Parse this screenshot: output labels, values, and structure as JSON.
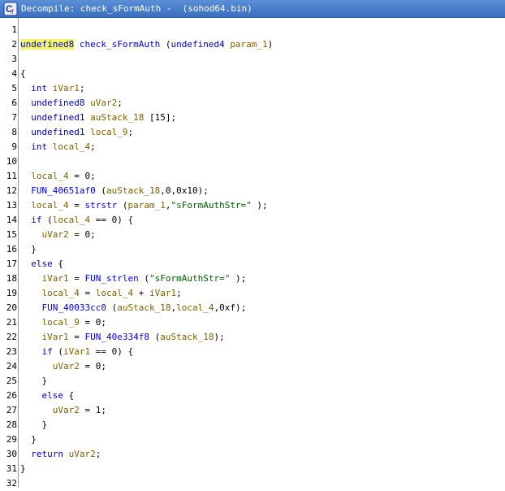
{
  "window": {
    "title": "Decompile: check_sFormAuth -  (sohod64.bin)",
    "icon": "ghidra-decompiler-icon"
  },
  "code_lines": [
    {
      "n": "1",
      "tokens": []
    },
    {
      "n": "2",
      "tokens": [
        {
          "t": "undefined8",
          "c": "kw",
          "hl": true
        },
        {
          "t": " ",
          "c": "pl"
        },
        {
          "t": "check_sFormAuth",
          "c": "fn"
        },
        {
          "t": " (",
          "c": "pl"
        },
        {
          "t": "undefined4",
          "c": "kw"
        },
        {
          "t": " ",
          "c": "pl"
        },
        {
          "t": "param_1",
          "c": "var"
        },
        {
          "t": ")",
          "c": "pl"
        }
      ]
    },
    {
      "n": "3",
      "tokens": []
    },
    {
      "n": "4",
      "tokens": [
        {
          "t": "{",
          "c": "pl"
        }
      ]
    },
    {
      "n": "5",
      "tokens": [
        {
          "t": "  ",
          "c": "pl"
        },
        {
          "t": "int",
          "c": "kw"
        },
        {
          "t": " ",
          "c": "pl"
        },
        {
          "t": "iVar1",
          "c": "var"
        },
        {
          "t": ";",
          "c": "pl"
        }
      ]
    },
    {
      "n": "6",
      "tokens": [
        {
          "t": "  ",
          "c": "pl"
        },
        {
          "t": "undefined8",
          "c": "kw"
        },
        {
          "t": " ",
          "c": "pl"
        },
        {
          "t": "uVar2",
          "c": "var"
        },
        {
          "t": ";",
          "c": "pl"
        }
      ]
    },
    {
      "n": "7",
      "tokens": [
        {
          "t": "  ",
          "c": "pl"
        },
        {
          "t": "undefined1",
          "c": "kw"
        },
        {
          "t": " ",
          "c": "pl"
        },
        {
          "t": "auStack_18",
          "c": "var"
        },
        {
          "t": " [15];",
          "c": "pl"
        }
      ]
    },
    {
      "n": "8",
      "tokens": [
        {
          "t": "  ",
          "c": "pl"
        },
        {
          "t": "undefined1",
          "c": "kw"
        },
        {
          "t": " ",
          "c": "pl"
        },
        {
          "t": "local_9",
          "c": "var"
        },
        {
          "t": ";",
          "c": "pl"
        }
      ]
    },
    {
      "n": "9",
      "tokens": [
        {
          "t": "  ",
          "c": "pl"
        },
        {
          "t": "int",
          "c": "kw"
        },
        {
          "t": " ",
          "c": "pl"
        },
        {
          "t": "local_4",
          "c": "var"
        },
        {
          "t": ";",
          "c": "pl"
        }
      ]
    },
    {
      "n": "10",
      "tokens": []
    },
    {
      "n": "11",
      "tokens": [
        {
          "t": "  ",
          "c": "pl"
        },
        {
          "t": "local_4",
          "c": "var"
        },
        {
          "t": " = 0;",
          "c": "pl"
        }
      ]
    },
    {
      "n": "12",
      "tokens": [
        {
          "t": "  ",
          "c": "pl"
        },
        {
          "t": "FUN_40651af0",
          "c": "fn"
        },
        {
          "t": " (",
          "c": "pl"
        },
        {
          "t": "auStack_18",
          "c": "var"
        },
        {
          "t": ",0,0x10);",
          "c": "pl"
        }
      ]
    },
    {
      "n": "13",
      "tokens": [
        {
          "t": "  ",
          "c": "pl"
        },
        {
          "t": "local_4",
          "c": "var"
        },
        {
          "t": " = ",
          "c": "pl"
        },
        {
          "t": "strstr",
          "c": "fn"
        },
        {
          "t": " (",
          "c": "pl"
        },
        {
          "t": "param_1",
          "c": "var"
        },
        {
          "t": ",",
          "c": "pl"
        },
        {
          "t": "\"sFormAuthStr=\"",
          "c": "str"
        },
        {
          "t": " );",
          "c": "pl"
        }
      ]
    },
    {
      "n": "14",
      "tokens": [
        {
          "t": "  ",
          "c": "pl"
        },
        {
          "t": "if",
          "c": "kw"
        },
        {
          "t": " (",
          "c": "pl"
        },
        {
          "t": "local_4",
          "c": "var"
        },
        {
          "t": " == 0) {",
          "c": "pl"
        }
      ]
    },
    {
      "n": "15",
      "tokens": [
        {
          "t": "    ",
          "c": "pl"
        },
        {
          "t": "uVar2",
          "c": "var"
        },
        {
          "t": " = 0;",
          "c": "pl"
        }
      ]
    },
    {
      "n": "16",
      "tokens": [
        {
          "t": "  }",
          "c": "pl"
        }
      ]
    },
    {
      "n": "17",
      "tokens": [
        {
          "t": "  ",
          "c": "pl"
        },
        {
          "t": "else",
          "c": "kw"
        },
        {
          "t": " {",
          "c": "pl"
        }
      ]
    },
    {
      "n": "18",
      "tokens": [
        {
          "t": "    ",
          "c": "pl"
        },
        {
          "t": "iVar1",
          "c": "var"
        },
        {
          "t": " = ",
          "c": "pl"
        },
        {
          "t": "FUN_strlen",
          "c": "fn"
        },
        {
          "t": " (",
          "c": "pl"
        },
        {
          "t": "\"sFormAuthStr=\"",
          "c": "str"
        },
        {
          "t": " );",
          "c": "pl"
        }
      ]
    },
    {
      "n": "19",
      "tokens": [
        {
          "t": "    ",
          "c": "pl"
        },
        {
          "t": "local_4",
          "c": "var"
        },
        {
          "t": " = ",
          "c": "pl"
        },
        {
          "t": "local_4",
          "c": "var"
        },
        {
          "t": " + ",
          "c": "pl"
        },
        {
          "t": "iVar1",
          "c": "var"
        },
        {
          "t": ";",
          "c": "pl"
        }
      ]
    },
    {
      "n": "20",
      "tokens": [
        {
          "t": "    ",
          "c": "pl"
        },
        {
          "t": "FUN_40033cc0",
          "c": "fn"
        },
        {
          "t": " (",
          "c": "pl"
        },
        {
          "t": "auStack_18",
          "c": "var"
        },
        {
          "t": ",",
          "c": "pl"
        },
        {
          "t": "local_4",
          "c": "var"
        },
        {
          "t": ",0xf);",
          "c": "pl"
        }
      ]
    },
    {
      "n": "21",
      "tokens": [
        {
          "t": "    ",
          "c": "pl"
        },
        {
          "t": "local_9",
          "c": "var"
        },
        {
          "t": " = 0;",
          "c": "pl"
        }
      ]
    },
    {
      "n": "22",
      "tokens": [
        {
          "t": "    ",
          "c": "pl"
        },
        {
          "t": "iVar1",
          "c": "var"
        },
        {
          "t": " = ",
          "c": "pl"
        },
        {
          "t": "FUN_40e334f8",
          "c": "fn"
        },
        {
          "t": " (",
          "c": "pl"
        },
        {
          "t": "auStack_18",
          "c": "var"
        },
        {
          "t": ");",
          "c": "pl"
        }
      ]
    },
    {
      "n": "23",
      "tokens": [
        {
          "t": "    ",
          "c": "pl"
        },
        {
          "t": "if",
          "c": "kw"
        },
        {
          "t": " (",
          "c": "pl"
        },
        {
          "t": "iVar1",
          "c": "var"
        },
        {
          "t": " == 0) {",
          "c": "pl"
        }
      ]
    },
    {
      "n": "24",
      "tokens": [
        {
          "t": "      ",
          "c": "pl"
        },
        {
          "t": "uVar2",
          "c": "var"
        },
        {
          "t": " = 0;",
          "c": "pl"
        }
      ]
    },
    {
      "n": "25",
      "tokens": [
        {
          "t": "    }",
          "c": "pl"
        }
      ]
    },
    {
      "n": "26",
      "tokens": [
        {
          "t": "    ",
          "c": "pl"
        },
        {
          "t": "else",
          "c": "kw"
        },
        {
          "t": " {",
          "c": "pl"
        }
      ]
    },
    {
      "n": "27",
      "tokens": [
        {
          "t": "      ",
          "c": "pl"
        },
        {
          "t": "uVar2",
          "c": "var"
        },
        {
          "t": " = 1;",
          "c": "pl"
        }
      ]
    },
    {
      "n": "28",
      "tokens": [
        {
          "t": "    }",
          "c": "pl"
        }
      ]
    },
    {
      "n": "29",
      "tokens": [
        {
          "t": "  }",
          "c": "pl"
        }
      ]
    },
    {
      "n": "30",
      "tokens": [
        {
          "t": "  ",
          "c": "pl"
        },
        {
          "t": "return",
          "c": "kw"
        },
        {
          "t": " ",
          "c": "pl"
        },
        {
          "t": "uVar2",
          "c": "var"
        },
        {
          "t": ";",
          "c": "pl"
        }
      ]
    },
    {
      "n": "31",
      "tokens": [
        {
          "t": "}",
          "c": "pl"
        }
      ]
    },
    {
      "n": "32",
      "tokens": []
    }
  ]
}
